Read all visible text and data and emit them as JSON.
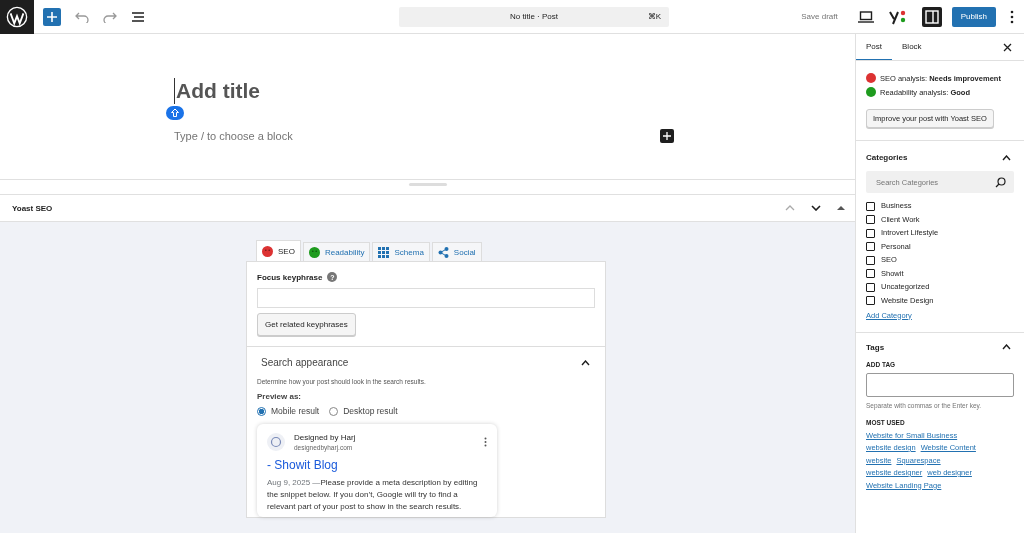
{
  "toolbar": {
    "command_title": "No title · Post",
    "shortcut": "⌘K",
    "save_draft": "Save draft",
    "publish": "Publish",
    "settings_selected": true
  },
  "editor": {
    "title_placeholder": "Add title",
    "block_placeholder": "Type / to choose a block"
  },
  "yoast": {
    "title": "Yoast SEO",
    "tabs": [
      {
        "label": "SEO",
        "kind": "face",
        "color": "#dc3232",
        "selected": true
      },
      {
        "label": "Readability",
        "kind": "face",
        "color": "#1e9b1e",
        "selected": false
      },
      {
        "label": "Schema",
        "kind": "grid",
        "selected": false
      },
      {
        "label": "Social",
        "kind": "share",
        "selected": false
      }
    ],
    "focus_label": "Focus keyphrase",
    "focus_help": "?",
    "related_button": "Get related keyphrases",
    "search_appearance": {
      "title": "Search appearance",
      "expanded": true,
      "description": "Determine how your post should look in the search results.",
      "preview_label": "Preview as:",
      "options": [
        {
          "label": "Mobile result",
          "selected": true
        },
        {
          "label": "Desktop result",
          "selected": false
        }
      ],
      "preview": {
        "site": "Designed by Harj",
        "url": "designedbyharj.com",
        "title": "- Showit Blog",
        "date": "Aug 9, 2025",
        "separator": "—",
        "snippet": "Please provide a meta description by editing the snippet below. If you don’t, Google will try to find a relevant part of your post to show in the search results."
      }
    }
  },
  "sidebar": {
    "tabs": [
      {
        "label": "Post",
        "selected": true
      },
      {
        "label": "Block",
        "selected": false
      }
    ],
    "analysis": [
      {
        "label": "SEO analysis: ",
        "value": "Needs improvement",
        "color": "#dc3232"
      },
      {
        "label": "Readability analysis: ",
        "value": "Good",
        "color": "#1e9b1e"
      }
    ],
    "improve_button": "Improve your post with Yoast SEO",
    "categories": {
      "title": "Categories",
      "expanded": true,
      "search_placeholder": "Search Categories",
      "items": [
        {
          "label": "Business",
          "checked": false
        },
        {
          "label": "Client Work",
          "checked": false
        },
        {
          "label": "Introvert Lifestyle",
          "checked": false
        },
        {
          "label": "Personal",
          "checked": false
        },
        {
          "label": "SEO",
          "checked": false
        },
        {
          "label": "Showit",
          "checked": false
        },
        {
          "label": "Uncategorized",
          "checked": false
        },
        {
          "label": "Website Design",
          "checked": false
        }
      ],
      "add_link": "Add Category"
    },
    "tags": {
      "title": "Tags",
      "expanded": true,
      "add_label": "ADD TAG",
      "help": "Separate with commas or the Enter key.",
      "most_used_label": "MOST USED",
      "rows": [
        [
          "Website for Small Business"
        ],
        [
          "website design",
          "Website Content"
        ],
        [
          "website",
          "Squarespace"
        ],
        [
          "website designer",
          "web designer"
        ],
        [
          "Website Landing Page"
        ]
      ]
    }
  }
}
